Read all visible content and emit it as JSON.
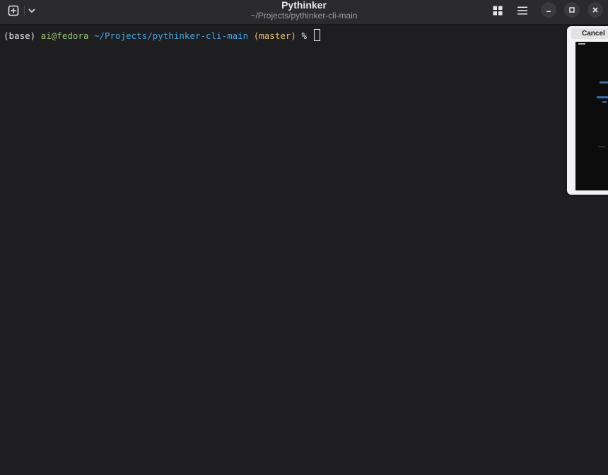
{
  "window": {
    "title": "Pythinker",
    "subtitle": "~/Projects/pythinker-cli-main"
  },
  "toolbar": {
    "new_tab_icon": "plus-square-icon",
    "tab_menu_icon": "chevron-down-icon",
    "overview_icon": "grid-icon",
    "menu_icon": "hamburger-icon",
    "minimize_icon": "minimize-icon",
    "maximize_icon": "maximize-icon",
    "close_icon": "close-icon"
  },
  "terminal": {
    "env": "(base)",
    "user_host": "ai@fedora",
    "path": "~/Projects/pythinker-cli-main",
    "branch": "(master)",
    "prompt_symbol": "%"
  },
  "preview": {
    "cancel_label": "Cancel"
  },
  "colors": {
    "background": "#1e1e20",
    "titlebar": "#2b2b2d",
    "user_host": "#98c379",
    "path": "#4aa3e0",
    "branch": "#e5c07b"
  }
}
